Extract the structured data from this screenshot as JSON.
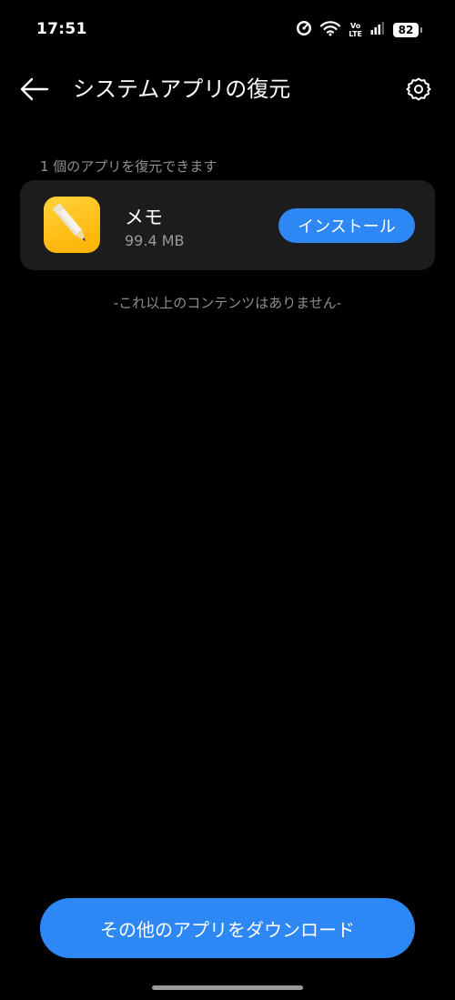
{
  "status_bar": {
    "time": "17:51",
    "network_top": "Vo",
    "network_bottom": "LTE",
    "battery": "82"
  },
  "app_bar": {
    "title": "システムアプリの復元"
  },
  "list": {
    "caption": "1 個のアプリを復元できます",
    "apps": [
      {
        "name": "メモ",
        "size": "99.4 MB",
        "action_label": "インストール",
        "icon": "notepad-pencil-icon"
      }
    ],
    "end_message": "-これ以上のコンテンツはありません-"
  },
  "footer": {
    "download_label": "その他のアプリをダウンロード"
  },
  "colors": {
    "background": "#000000",
    "card": "#1c1c1e",
    "accent": "#2d87f5",
    "secondary_text": "#8f8f8f",
    "app_icon": "#ffc21a"
  }
}
